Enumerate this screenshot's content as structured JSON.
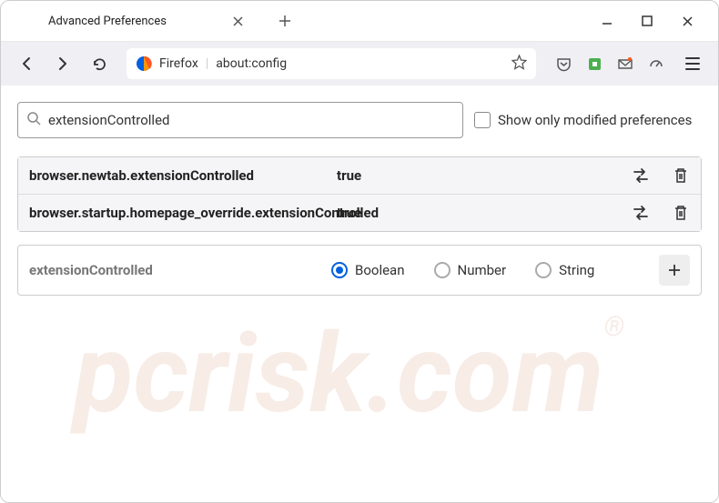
{
  "window": {
    "tab_title": "Advanced Preferences"
  },
  "urlbar": {
    "brand": "Firefox",
    "url": "about:config"
  },
  "search": {
    "value": "extensionControlled",
    "checkbox_label": "Show only modified preferences"
  },
  "prefs": [
    {
      "name": "browser.newtab.extensionControlled",
      "value": "true"
    },
    {
      "name": "browser.startup.homepage_override.extensionControlled",
      "value": "true"
    }
  ],
  "new_pref": {
    "name": "extensionControlled",
    "types": [
      {
        "label": "Boolean",
        "selected": true
      },
      {
        "label": "Number",
        "selected": false
      },
      {
        "label": "String",
        "selected": false
      }
    ]
  },
  "watermark": "pcrisk.com"
}
